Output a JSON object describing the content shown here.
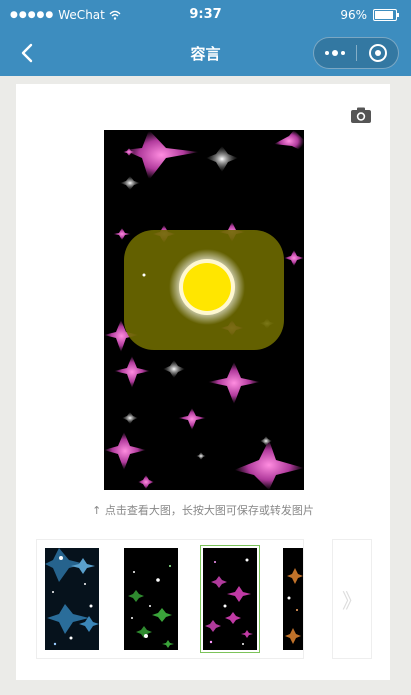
{
  "status_bar": {
    "carrier": "WeChat",
    "signal_dots": "●●●●●",
    "time": "9:37",
    "battery": "96%"
  },
  "nav": {
    "title": "容言"
  },
  "content": {
    "hint_arrow": "↑",
    "hint": "点击查看大图，长按大图可保存或转发图片",
    "next_glyph": "》"
  },
  "colors": {
    "nav_bg": "#3d8dbf",
    "selected_outline": "#7cc35a"
  },
  "icons": [
    "back-icon",
    "more-icon",
    "close-mini-program-icon",
    "camera-icon",
    "wifi-icon",
    "battery-icon"
  ]
}
